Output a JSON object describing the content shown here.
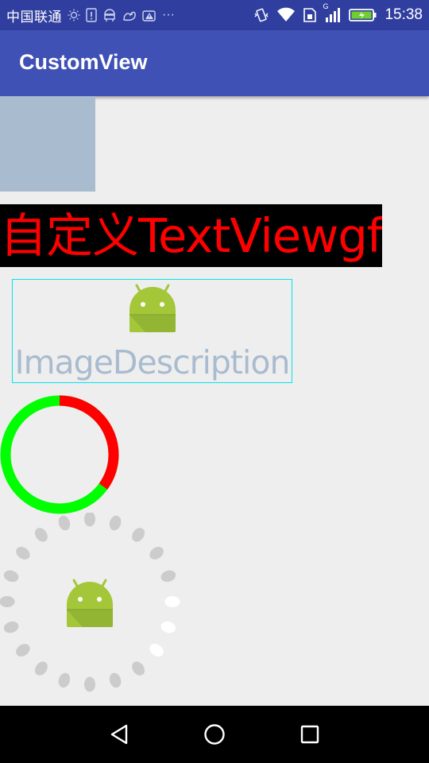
{
  "status_bar": {
    "carrier": "中国联通",
    "time": "15:38",
    "more": "···",
    "signal_label": "G"
  },
  "app_bar": {
    "title": "CustomView"
  },
  "custom_text_view": {
    "text": "自定义TextViewgf",
    "text_color": "#ff0000",
    "background": "#000000"
  },
  "image_view": {
    "description": "ImageDescription",
    "border_color": "#00e5ee",
    "icon": "android-icon"
  },
  "progress_ring": {
    "progress": 0.35,
    "progress_color": "#ff0000",
    "track_color": "#00ff00"
  },
  "loading_ring": {
    "total_dots": 20,
    "active_dots": 3,
    "dot_color": "#cccccc",
    "active_color": "#ffffff",
    "icon": "android-icon"
  },
  "nav_bar": {
    "buttons": [
      "back-icon",
      "home-icon",
      "recents-icon"
    ]
  }
}
